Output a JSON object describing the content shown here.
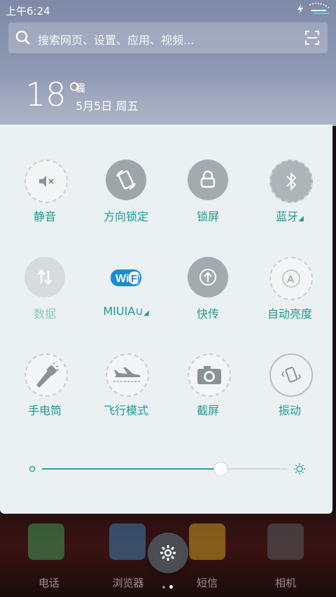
{
  "status": {
    "time": "上午6:24"
  },
  "search": {
    "placeholder": "搜索网页、设置、应用、视频..."
  },
  "weather": {
    "temperature": "18°",
    "condition": "霾",
    "date": "5月5日 周五"
  },
  "toggles": [
    {
      "label": "静音",
      "icon": "mute-icon"
    },
    {
      "label": "方向锁定",
      "icon": "rotation-lock-icon"
    },
    {
      "label": "锁屏",
      "icon": "lock-icon"
    },
    {
      "label": "蓝牙",
      "icon": "bluetooth-icon"
    },
    {
      "label": "数据",
      "icon": "data-icon"
    },
    {
      "label": "MIUIA∪",
      "icon": "wifi-icon"
    },
    {
      "label": "快传",
      "icon": "transfer-icon"
    },
    {
      "label": "自动亮度",
      "icon": "auto-brightness-icon"
    },
    {
      "label": "手电筒",
      "icon": "flashlight-icon"
    },
    {
      "label": "飞行模式",
      "icon": "airplane-icon"
    },
    {
      "label": "截屏",
      "icon": "screenshot-icon"
    },
    {
      "label": "振动",
      "icon": "vibrate-icon"
    }
  ],
  "brightness": {
    "level": 0.73
  },
  "dock": [
    {
      "label": "电话"
    },
    {
      "label": "浏览器"
    },
    {
      "label": "短信"
    },
    {
      "label": "相机"
    }
  ],
  "colors": {
    "accent": "#1f9b93",
    "panel": "#ebf0f2"
  }
}
